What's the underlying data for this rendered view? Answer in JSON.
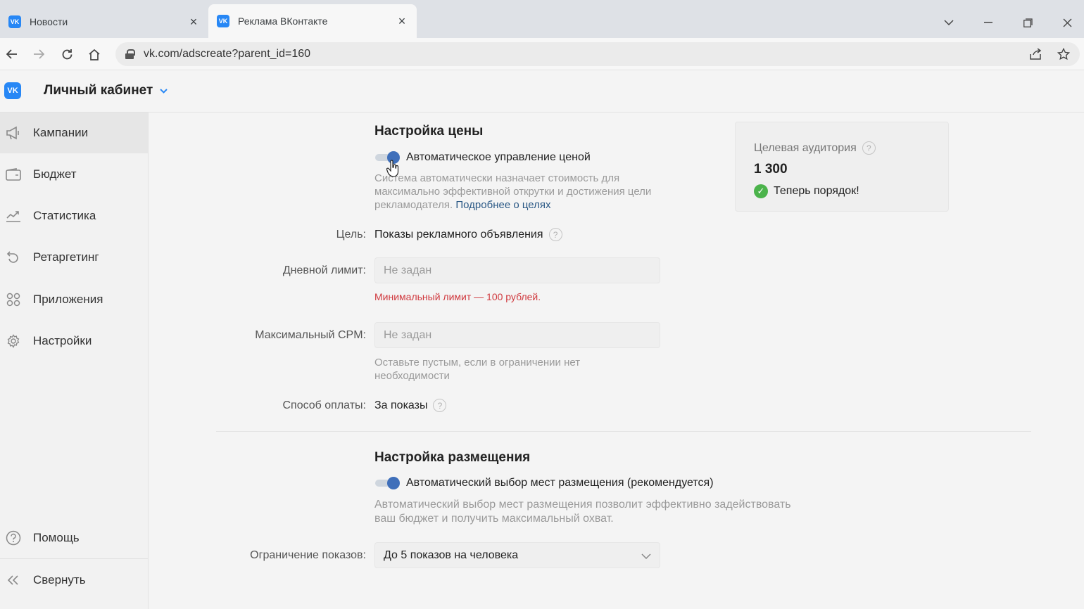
{
  "browser": {
    "tabs": [
      {
        "title": "Новости",
        "favicon": "VK",
        "active": false
      },
      {
        "title": "Реклама ВКонтакте",
        "favicon": "VK",
        "active": true
      }
    ],
    "url": "vk.com/adscreate?parent_id=160"
  },
  "header": {
    "logo": "VK",
    "cabinet_label": "Личный кабинет"
  },
  "sidebar": {
    "items": [
      {
        "label": "Кампании",
        "icon": "megaphone-icon",
        "active": true
      },
      {
        "label": "Бюджет",
        "icon": "wallet-icon",
        "active": false
      },
      {
        "label": "Статистика",
        "icon": "chart-icon",
        "active": false
      },
      {
        "label": "Ретаргетинг",
        "icon": "retarget-icon",
        "active": false
      },
      {
        "label": "Приложения",
        "icon": "apps-icon",
        "active": false
      },
      {
        "label": "Настройки",
        "icon": "gear-icon",
        "active": false
      }
    ],
    "help_label": "Помощь",
    "collapse_label": "Свернуть"
  },
  "price": {
    "title": "Настройка цены",
    "auto_label": "Автоматическое управление ценой",
    "auto_enabled": true,
    "auto_hint": "Система автоматически назначает стоимость для максимально эффективной открутки и достижения цели рекламодателя.",
    "auto_hint_link": "Подробнее о целях",
    "goal_label": "Цель:",
    "goal_value": "Показы рекламного объявления",
    "daily_limit_label": "Дневной лимит:",
    "daily_limit_placeholder": "Не задан",
    "daily_limit_error": "Минимальный лимит — 100 рублей.",
    "max_cpm_label": "Максимальный CPM:",
    "max_cpm_placeholder": "Не задан",
    "max_cpm_hint": "Оставьте пустым, если в ограничении нет необходимости",
    "payment_label": "Способ оплаты:",
    "payment_value": "За показы"
  },
  "placement": {
    "title": "Настройка размещения",
    "auto_label": "Автоматический выбор мест размещения (рекомендуется)",
    "auto_enabled": true,
    "auto_hint": "Автоматический выбор мест размещения позволит эффективно задействовать ваш бюджет и получить максимальный охват.",
    "limit_label": "Ограничение показов:",
    "limit_value": "До 5 показов на человека"
  },
  "audience": {
    "title": "Целевая аудитория",
    "count": "1 300",
    "status": "Теперь порядок!"
  },
  "colors": {
    "accent": "#2787f5",
    "toggle_on": "#3f6fba",
    "error": "#d0393e",
    "success": "#4bb34b",
    "link": "#2a5885"
  }
}
